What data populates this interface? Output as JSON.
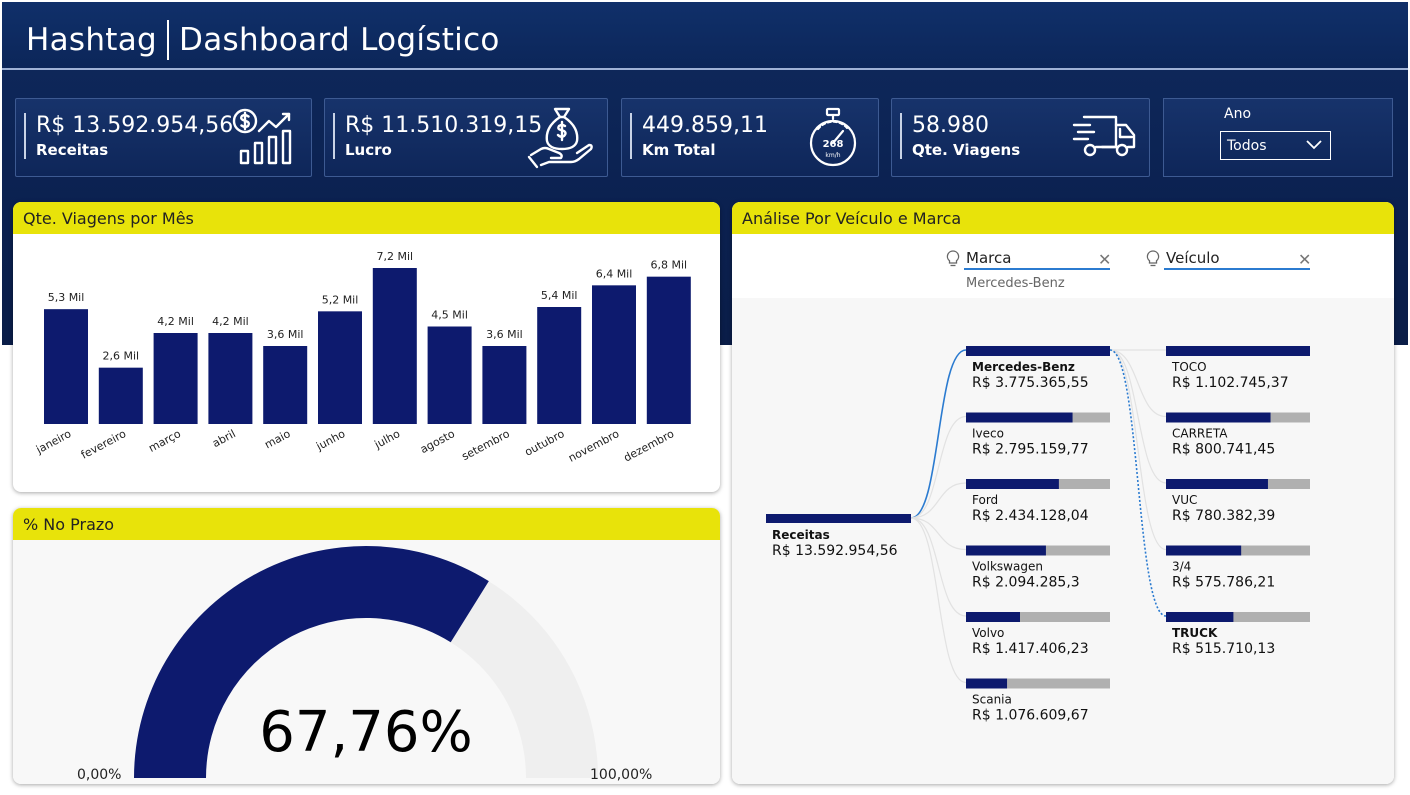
{
  "header": {
    "brand": "Hashtag",
    "title": "Dashboard Logístico"
  },
  "kpis": [
    {
      "value": "R$ 13.592.954,56",
      "label": "Receitas",
      "icon": "revenue-chart-icon"
    },
    {
      "value": "R$ 11.510.319,15",
      "label": "Lucro",
      "icon": "money-bag-hand-icon"
    },
    {
      "value": "449.859,11",
      "label": "Km Total",
      "icon": "speedometer-icon"
    },
    {
      "value": "58.980",
      "label": "Qte. Viagens",
      "icon": "delivery-truck-icon"
    }
  ],
  "speedo_text": {
    "num": "268",
    "unit": "km/h"
  },
  "year_filter": {
    "label": "Ano",
    "selected": "Todos"
  },
  "bar_panel": {
    "title": "Qte. Viagens por Mês"
  },
  "gauge_panel": {
    "title": "% No Prazo",
    "value_text": "67,76%",
    "min_label": "0,00%",
    "max_label": "100,00%",
    "fraction": 0.6776
  },
  "tree_panel": {
    "title": "Análise Por Veículo e Marca",
    "filters": [
      {
        "label": "Marca",
        "value": "Mercedes-Benz"
      },
      {
        "label": "Veículo",
        "value": ""
      }
    ],
    "root": {
      "label": "Receitas",
      "value": "R$ 13.592.954,56"
    },
    "brands": [
      {
        "label": "Mercedes-Benz",
        "value": "R$ 3.775.365,55",
        "share": 1.0,
        "selected": true
      },
      {
        "label": "Iveco",
        "value": "R$ 2.795.159,77",
        "share": 0.74,
        "selected": false
      },
      {
        "label": "Ford",
        "value": "R$ 2.434.128,04",
        "share": 0.645,
        "selected": false
      },
      {
        "label": "Volkswagen",
        "value": "R$ 2.094.285,3",
        "share": 0.555,
        "selected": false
      },
      {
        "label": "Volvo",
        "value": "R$ 1.417.406,23",
        "share": 0.375,
        "selected": false
      },
      {
        "label": "Scania",
        "value": "R$ 1.076.609,67",
        "share": 0.285,
        "selected": false
      }
    ],
    "vehicles": [
      {
        "label": "TOCO",
        "value": "R$ 1.102.745,37",
        "share": 1.0,
        "selected": false
      },
      {
        "label": "CARRETA",
        "value": "R$ 800.741,45",
        "share": 0.726,
        "selected": false
      },
      {
        "label": "VUC",
        "value": "R$ 780.382,39",
        "share": 0.708,
        "selected": false
      },
      {
        "label": "3/4",
        "value": "R$ 575.786,21",
        "share": 0.522,
        "selected": false
      },
      {
        "label": "TRUCK",
        "value": "R$ 515.710,13",
        "share": 0.468,
        "selected": true
      }
    ]
  },
  "colors": {
    "navy": "#0d1a6e",
    "yellow": "#e8e30a",
    "gray_bar": "#b0b0b0",
    "gauge_track": "#efefef",
    "accent_blue": "#2b7bd0"
  },
  "chart_data": {
    "type": "bar",
    "title": "Qte. Viagens por Mês",
    "categories": [
      "janeiro",
      "fevereiro",
      "março",
      "abril",
      "maio",
      "junho",
      "julho",
      "agosto",
      "setembro",
      "outubro",
      "novembro",
      "dezembro"
    ],
    "values": [
      5.3,
      2.6,
      4.2,
      4.2,
      3.6,
      5.2,
      7.2,
      4.5,
      3.6,
      5.4,
      6.4,
      6.8
    ],
    "data_labels": [
      "5,3 Mil",
      "2,6 Mil",
      "4,2 Mil",
      "4,2 Mil",
      "3,6 Mil",
      "5,2 Mil",
      "7,2 Mil",
      "4,5 Mil",
      "3,6 Mil",
      "5,4 Mil",
      "6,4 Mil",
      "6,8 Mil"
    ],
    "unit": "Mil",
    "ylim": [
      0,
      7.2
    ],
    "grid": false,
    "xlabel": "",
    "ylabel": ""
  }
}
